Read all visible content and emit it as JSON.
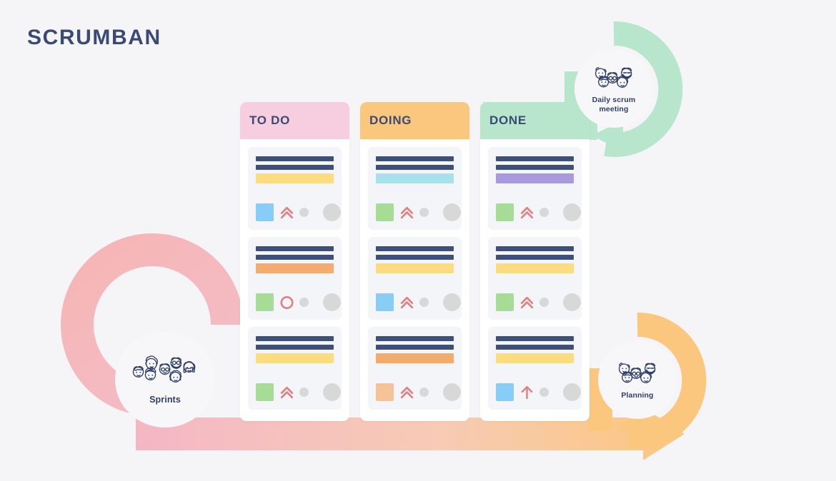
{
  "page": {
    "title": "SCRUMBAN",
    "background_color": "#f5f5f7",
    "title_color": "#3a4a73"
  },
  "board": {
    "columns": [
      {
        "id": "todo",
        "label": "TO DO",
        "header_color": "#f7cde0",
        "cards": [
          {
            "bar_color": "#fbdd80",
            "tag_color": "#87cdf5",
            "priority_icon": "double-chevron-up-icon",
            "priority_color": "#e08184",
            "has_dot": true,
            "has_avatar": true
          },
          {
            "bar_color": "#f3ab6e",
            "tag_color": "#a7dc97",
            "priority_icon": "circle-outline-icon",
            "priority_color": "#e08184",
            "has_dot": true,
            "has_avatar": true
          },
          {
            "bar_color": "#fbdd80",
            "tag_color": "#a7dc97",
            "priority_icon": "double-chevron-up-icon",
            "priority_color": "#e08184",
            "has_dot": true,
            "has_avatar": true
          }
        ]
      },
      {
        "id": "doing",
        "label": "DOING",
        "header_color": "#fbc77e",
        "cards": [
          {
            "bar_color": "#a7e1ec",
            "tag_color": "#a7dc97",
            "priority_icon": "double-chevron-up-icon",
            "priority_color": "#e08184",
            "has_dot": true,
            "has_avatar": true
          },
          {
            "bar_color": "#fbdd80",
            "tag_color": "#87cdf5",
            "priority_icon": "double-chevron-up-icon",
            "priority_color": "#e08184",
            "has_dot": true,
            "has_avatar": true
          },
          {
            "bar_color": "#f3ab6e",
            "tag_color": "#f6c398",
            "priority_icon": "double-chevron-up-icon",
            "priority_color": "#e08184",
            "has_dot": true,
            "has_avatar": true
          }
        ]
      },
      {
        "id": "done",
        "label": "DONE",
        "header_color": "#b8e6cd",
        "cards": [
          {
            "bar_color": "#a99ae0",
            "tag_color": "#a7dc97",
            "priority_icon": "double-chevron-up-icon",
            "priority_color": "#e08184",
            "has_dot": true,
            "has_avatar": true
          },
          {
            "bar_color": "#fbdd80",
            "tag_color": "#a7dc97",
            "priority_icon": "double-chevron-up-icon",
            "priority_color": "#e08184",
            "has_dot": true,
            "has_avatar": true
          },
          {
            "bar_color": "#fbdd80",
            "tag_color": "#87cdf5",
            "priority_icon": "arrow-up-icon",
            "priority_color": "#e08184",
            "has_dot": true,
            "has_avatar": true
          }
        ]
      }
    ],
    "card_line_color": "#3e4f79",
    "card_background": "#f4f5f8",
    "dot_color": "#d8d8d8"
  },
  "badges": [
    {
      "id": "daily-scrum",
      "label": "Daily scrum meeting",
      "label_line1": "Daily scrum",
      "label_line2": "meeting",
      "ring_color": "#b8e6cd",
      "icon": "people-faces-icon",
      "face_count": 5
    },
    {
      "id": "planning",
      "label": "Planning",
      "ring_color": "#fbc77e",
      "icon": "people-faces-icon",
      "face_count": 5
    },
    {
      "id": "sprints",
      "label": "Sprints",
      "ring_color": "#f5b4bd",
      "icon": "people-faces-icon",
      "face_count": 7
    }
  ],
  "flow": {
    "arrow_gradient_start": "#f4b8c5",
    "arrow_gradient_end": "#fbc77e",
    "arrow_direction": "right"
  }
}
